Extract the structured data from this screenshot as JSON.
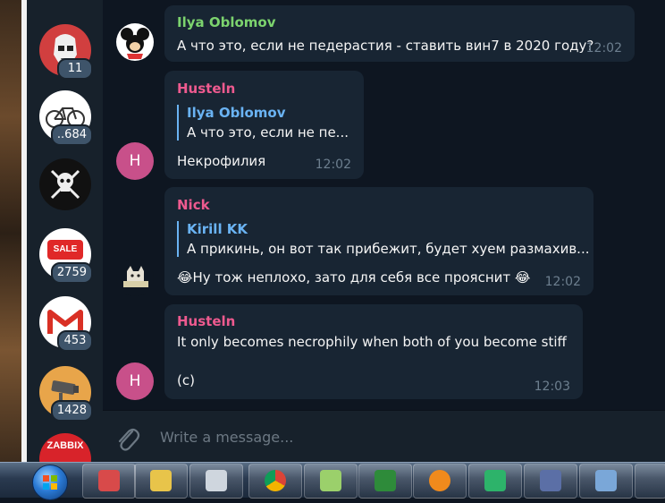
{
  "sidebar": {
    "chats": [
      {
        "name": "stormtrooper",
        "badge": "11"
      },
      {
        "name": "bicycle",
        "badge": "..684"
      },
      {
        "name": "jolly-roger",
        "badge": ""
      },
      {
        "name": "sale",
        "badge": "2759",
        "avatar_text": "SALE"
      },
      {
        "name": "gmail",
        "badge": "453"
      },
      {
        "name": "camera",
        "badge": "1428"
      },
      {
        "name": "zabbix",
        "badge": "",
        "avatar_text": "ZABBIX"
      }
    ]
  },
  "messages": [
    {
      "author": "Ilya Oblomov",
      "author_color": "#7cd36e",
      "text": "А что это, если не педерастия - ставить вин7 в 2020 году?",
      "time": "12:02"
    },
    {
      "author": "Husteln",
      "author_color": "#ee5a8f",
      "avatar_letter": "H",
      "reply": {
        "author": "Ilya Oblomov",
        "text": "А что это, если не пе..."
      },
      "text": "Некрофилия",
      "time": "12:02"
    },
    {
      "author": "Nick",
      "author_color": "#ee5a8f",
      "reply": {
        "author": "Kirill KK",
        "text": "А прикинь, он вот так прибежит, будет хуем размахив..."
      },
      "text": "Ну тож неплохо, зато для себя все прояснит",
      "emoji_left": "😂",
      "emoji_right": "😂",
      "time": "12:02"
    },
    {
      "author": "Husteln",
      "author_color": "#ee5a8f",
      "avatar_letter": "H",
      "text": "It only becomes necrophily when both of you become stiff",
      "text2": "(c)",
      "time": "12:03"
    }
  ],
  "composer": {
    "placeholder": "Write a message..."
  },
  "colors": {
    "accent": "#6ab3f3",
    "bubble": "#182533",
    "background": "#0e1621",
    "sidebar": "#17212b"
  }
}
